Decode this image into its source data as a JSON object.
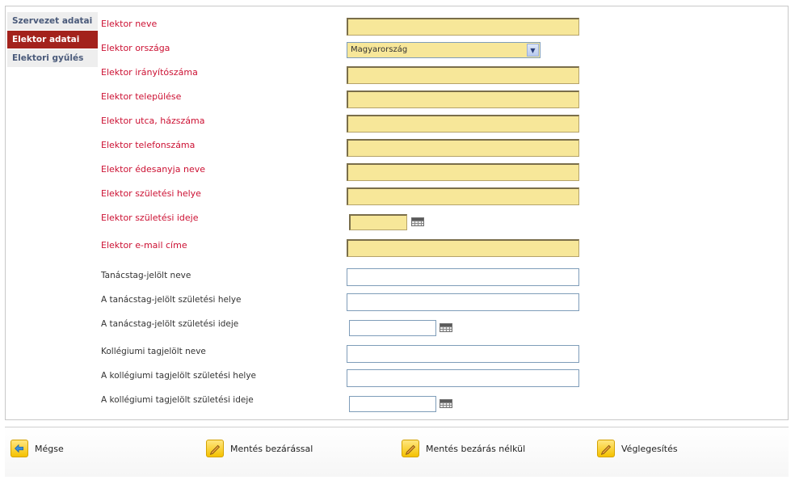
{
  "sidebar": {
    "items": [
      {
        "label": "Szervezet adatai"
      },
      {
        "label": "Elektor adatai"
      },
      {
        "label": "Elektori gyűlés"
      }
    ]
  },
  "form": {
    "elector_name_label": "Elektor neve",
    "elector_country_label": "Elektor országa",
    "elector_country_value": "Magyarország",
    "elector_zip_label": "Elektor irányítószáma",
    "elector_city_label": "Elektor települése",
    "elector_street_label": "Elektor utca, házszáma",
    "elector_phone_label": "Elektor telefonszáma",
    "elector_mother_label": "Elektor édesanyja neve",
    "elector_birthplace_label": "Elektor születési helye",
    "elector_birthdate_label": "Elektor születési ideje",
    "elector_email_label": "Elektor e-mail címe",
    "council_name_label": "Tanácstag-jelölt neve",
    "council_birthplace_label": "A tanácstag-jelölt születési helye",
    "council_birthdate_label": "A tanácstag-jelölt születési ideje",
    "college_name_label": "Kollégiumi tagjelölt neve",
    "college_birthplace_label": "A kollégiumi tagjelölt születési helye",
    "college_birthdate_label": "A kollégiumi tagjelölt születési ideje"
  },
  "footer": {
    "cancel_label": "Mégse",
    "save_close_label": "Mentés bezárással",
    "save_noclose_label": "Mentés bezárás nélkül",
    "finalize_label": "Véglegesítés"
  },
  "colors": {
    "required_label": "#cc1133",
    "active_tab": "#a3221c",
    "required_field": "#f7e799"
  }
}
